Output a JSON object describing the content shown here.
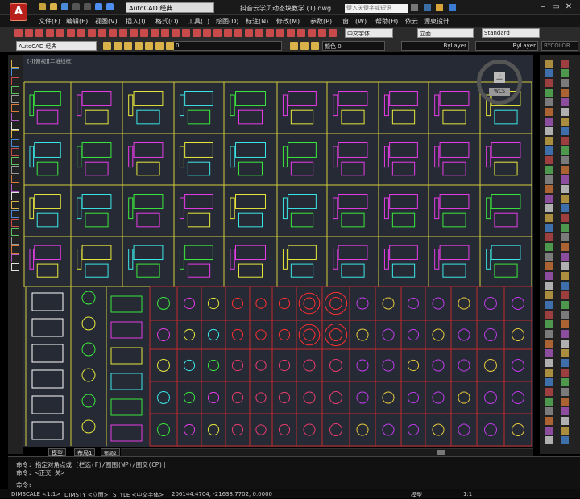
{
  "title": {
    "workspace": "AutoCAD 经典",
    "document": "抖音云学贝动态块教学 (1).dwg",
    "search_placeholder": "键入关键字或短语",
    "window_buttons": [
      "–",
      "▭",
      "✕"
    ]
  },
  "menu": [
    "文件(F)",
    "编辑(E)",
    "视图(V)",
    "插入(I)",
    "格式(O)",
    "工具(T)",
    "绘图(D)",
    "标注(N)",
    "修改(M)",
    "参数(P)",
    "窗口(W)",
    "帮助(H)",
    "依云",
    "源泉设计"
  ],
  "toolbar": {
    "text_style": "中文字体",
    "dim_style": "立面",
    "table_style": "Standard",
    "workspace2": "AutoCAD 经典",
    "layer": "0",
    "color": "颜色 0",
    "linetype": "ByLayer",
    "lineweight": "ByLayer",
    "plotstyle": "BYCOLOR"
  },
  "viewcube": {
    "label": "上",
    "wcs": "WCS"
  },
  "viewport_label": "[-][俯视][二维线框]",
  "layout_tabs": [
    "模型",
    "布局1",
    "布局2"
  ],
  "command": {
    "history": [
      "命令: 指定对角点或 [栏选(F)/圈围(WP)/圈交(CP)]:",
      "命令: <正交 关>"
    ],
    "prompt": "命令:"
  },
  "status": {
    "dimscale": "DIMSCALE <1:1>",
    "dimsty": "DIMSTY <立面>",
    "style": "STYLE <中文字体>",
    "coords": "206144.4704, -21638.7702, 0.0000",
    "model": "模型",
    "scale": "1:1"
  },
  "colors": {
    "grid_yellow": "#d2cc3a",
    "grid_red": "#c42a2a",
    "canvas": "#252a35"
  }
}
